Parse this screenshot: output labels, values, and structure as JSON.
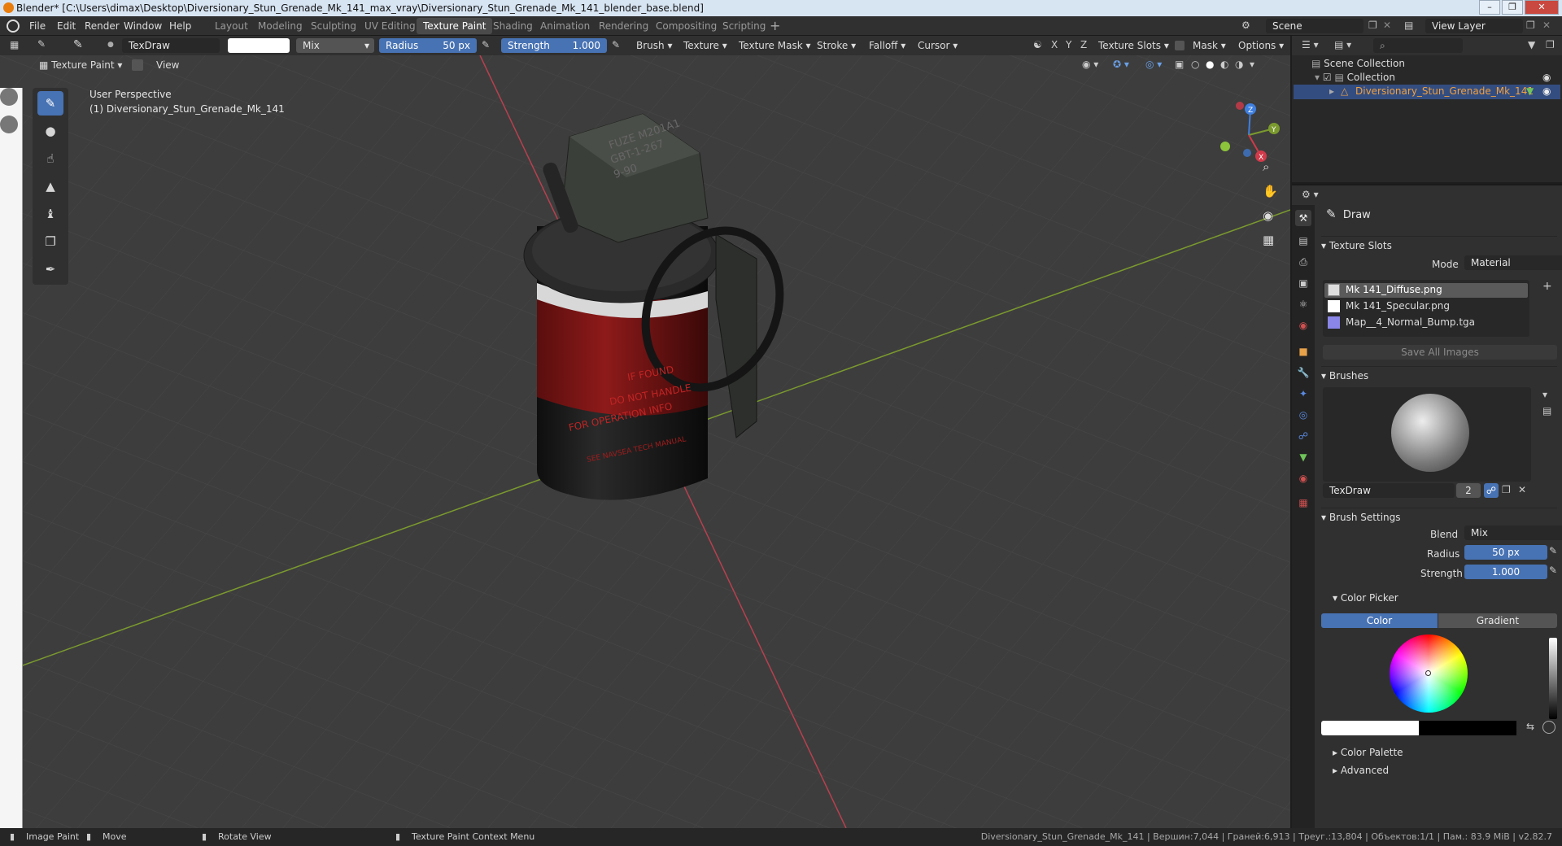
{
  "window": {
    "title": "Blender* [C:\\Users\\dimax\\Desktop\\Diversionary_Stun_Grenade_Mk_141_max_vray\\Diversionary_Stun_Grenade_Mk_141_blender_base.blend]"
  },
  "menu": [
    "File",
    "Edit",
    "Render",
    "Window",
    "Help"
  ],
  "workspaces": [
    "Layout",
    "Modeling",
    "Sculpting",
    "UV Editing",
    "Texture Paint",
    "Shading",
    "Animation",
    "Rendering",
    "Compositing",
    "Scripting"
  ],
  "active_workspace": "Texture Paint",
  "scene": {
    "name": "Scene",
    "view_layer": "View Layer"
  },
  "toolbar": {
    "brush_name": "TexDraw",
    "blend": "Mix",
    "radius_label": "Radius",
    "radius_value": "50 px",
    "strength_label": "Strength",
    "strength_value": "1.000",
    "menus": [
      "Brush",
      "Texture",
      "Texture Mask",
      "Stroke",
      "Falloff",
      "Cursor"
    ],
    "axes": [
      "X",
      "Y",
      "Z"
    ],
    "right_menus": [
      "Texture Slots",
      "Mask",
      "Options"
    ]
  },
  "viewport": {
    "mode": "Texture Paint",
    "view_menu": "View",
    "perspective": "User Perspective",
    "object_label": "(1) Diversionary_Stun_Grenade_Mk_141",
    "gizmo_axes": [
      "Z",
      "Y",
      "X"
    ],
    "model_text": {
      "fuze": [
        "FUZE M201A1",
        "GBT-1-267",
        "9-90"
      ],
      "body": [
        "IF FOUND",
        "DO NOT HANDLE",
        "FOR OPERATION INFO",
        "SEE NAVSEA TECH MANUAL"
      ]
    }
  },
  "outliner": {
    "scene_collection": "Scene Collection",
    "collection": "Collection",
    "object": "Diversionary_Stun_Grenade_Mk_141"
  },
  "properties": {
    "tool_name": "Draw",
    "texture_slots": {
      "header": "Texture Slots",
      "mode_label": "Mode",
      "mode_value": "Material",
      "slots": [
        "Mk 141_Diffuse.png",
        "Mk 141_Specular.png",
        "Map__4_Normal_Bump.tga"
      ],
      "save_all": "Save All Images"
    },
    "brushes": {
      "header": "Brushes",
      "name": "TexDraw",
      "users": "2"
    },
    "brush_settings": {
      "header": "Brush Settings",
      "blend_label": "Blend",
      "blend_value": "Mix",
      "radius_label": "Radius",
      "radius_value": "50 px",
      "strength_label": "Strength",
      "strength_value": "1.000"
    },
    "color_picker": {
      "header": "Color Picker",
      "tab_color": "Color",
      "tab_gradient": "Gradient"
    },
    "color_palette": "Color Palette",
    "advanced": "Advanced"
  },
  "statusbar": {
    "left": [
      {
        "icon": "mouse-left-icon",
        "label": "Image Paint"
      },
      {
        "icon": "mouse-drag-icon",
        "label": "Move"
      },
      {
        "icon": "mouse-middle-icon",
        "label": "Rotate View"
      },
      {
        "icon": "mouse-right-icon",
        "label": "Texture Paint Context Menu"
      }
    ],
    "stats": "Diversionary_Stun_Grenade_Mk_141 | Вершин:7,044 | Граней:6,913 | Треуг.:13,804 | Объектов:1/1 | Пам.: 83.9 MiB | v2.82.7"
  },
  "colors": {
    "accent": "#4772b3",
    "header_bg": "#303030",
    "viewport_bg": "#3d3d3d",
    "x_axis": "#b8404f",
    "y_axis": "#7b9a2e",
    "primary_color": "#ffffff",
    "secondary_color": "#000000"
  }
}
